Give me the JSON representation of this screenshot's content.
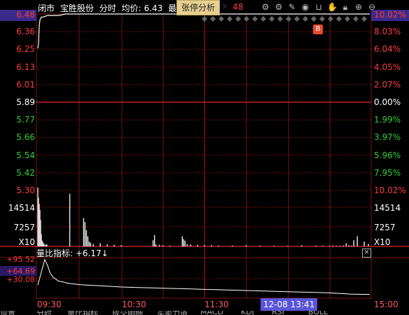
{
  "header": {
    "status": "闭市",
    "stock_name": "宝胜股份",
    "mode": "分时",
    "avg_label": "均价:",
    "avg_value": "6.43",
    "latest_label": "最新:",
    "latest_value_partial": "48",
    "zt_button": "张停分析",
    "zt_close": "×"
  },
  "toolbar_icons": [
    "gear-icon",
    "gear-icon",
    "pen-icon",
    "eye-icon",
    "basket-icon",
    "hand-icon",
    "lock-icon",
    "plus-icon",
    "minus-icon"
  ],
  "price_axis": {
    "left": [
      "6.48",
      "6.36",
      "6.25",
      "6.13",
      "6.01",
      "5.89",
      "5.77",
      "5.66",
      "5.54",
      "5.42",
      "5.30"
    ],
    "right": [
      "10.02%",
      "8.03%",
      "6.04%",
      "4.05%",
      "2.07%",
      "0.00%",
      "1.99%",
      "3.97%",
      "5.96%",
      "7.95%",
      "10.02%"
    ]
  },
  "volume_axis": {
    "left": [
      "14514",
      "7257",
      "X10"
    ],
    "right": [
      "14514",
      "7257",
      "X10"
    ]
  },
  "liangbi": {
    "title": "量比指标: +6.17↓",
    "left": [
      "+95.52",
      "+64.69",
      "+30.08"
    ]
  },
  "time_axis": {
    "labels": [
      "09:30",
      "10:30",
      "11:30",
      "15:00"
    ],
    "cursor": "12-08 13:41"
  },
  "badge": "B",
  "bottom_tabs": [
    "设置",
    "分时",
    "量比指标",
    "成交明细",
    "买卖力道",
    "MACD",
    "KDJ",
    "RSI",
    "BOLL"
  ],
  "colors": {
    "up": "#ff3b3b",
    "down": "#2fd02f",
    "grid": "#7a1212",
    "price_line": "#ffffff"
  },
  "chart_data": {
    "type": "line",
    "price_series": {
      "x": [
        "09:30",
        "09:31",
        "09:32",
        "09:33",
        "09:35",
        "09:40",
        "09:45",
        "09:50",
        "10:00",
        "10:10",
        "10:20",
        "10:30",
        "11:00",
        "11:30",
        "13:00",
        "13:30",
        "14:00",
        "14:30",
        "15:00"
      ],
      "values": [
        6.25,
        6.28,
        6.4,
        6.44,
        6.46,
        6.46,
        6.47,
        6.47,
        6.47,
        6.48,
        6.48,
        6.48,
        6.48,
        6.48,
        6.48,
        6.48,
        6.48,
        6.48,
        6.48
      ]
    },
    "volume_series": {
      "max": 14514,
      "values": [
        14514,
        12000,
        10500,
        9000,
        6500,
        3000,
        1500,
        1200,
        800,
        600,
        13000,
        400,
        300,
        500,
        7000,
        6000,
        4000,
        2500,
        1200,
        900,
        600,
        800,
        500,
        400,
        300,
        1500,
        2800,
        500,
        400,
        300,
        200,
        2500,
        1800,
        1400,
        600,
        500,
        400,
        300,
        300,
        200,
        200,
        300,
        200,
        150,
        150,
        300,
        200,
        150,
        150,
        200,
        150,
        150,
        200,
        800,
        300,
        200,
        1500,
        2500,
        1200,
        600
      ]
    },
    "liangbi_series": {
      "values": [
        30,
        95,
        80,
        60,
        50,
        45,
        40,
        38,
        35,
        33,
        31,
        30,
        29,
        28,
        27,
        26,
        25,
        24,
        23,
        22,
        21,
        20,
        19,
        18,
        17,
        16,
        15,
        14,
        13,
        12,
        11,
        10,
        9,
        8,
        7,
        6.5,
        6.2,
        6.17
      ]
    }
  }
}
